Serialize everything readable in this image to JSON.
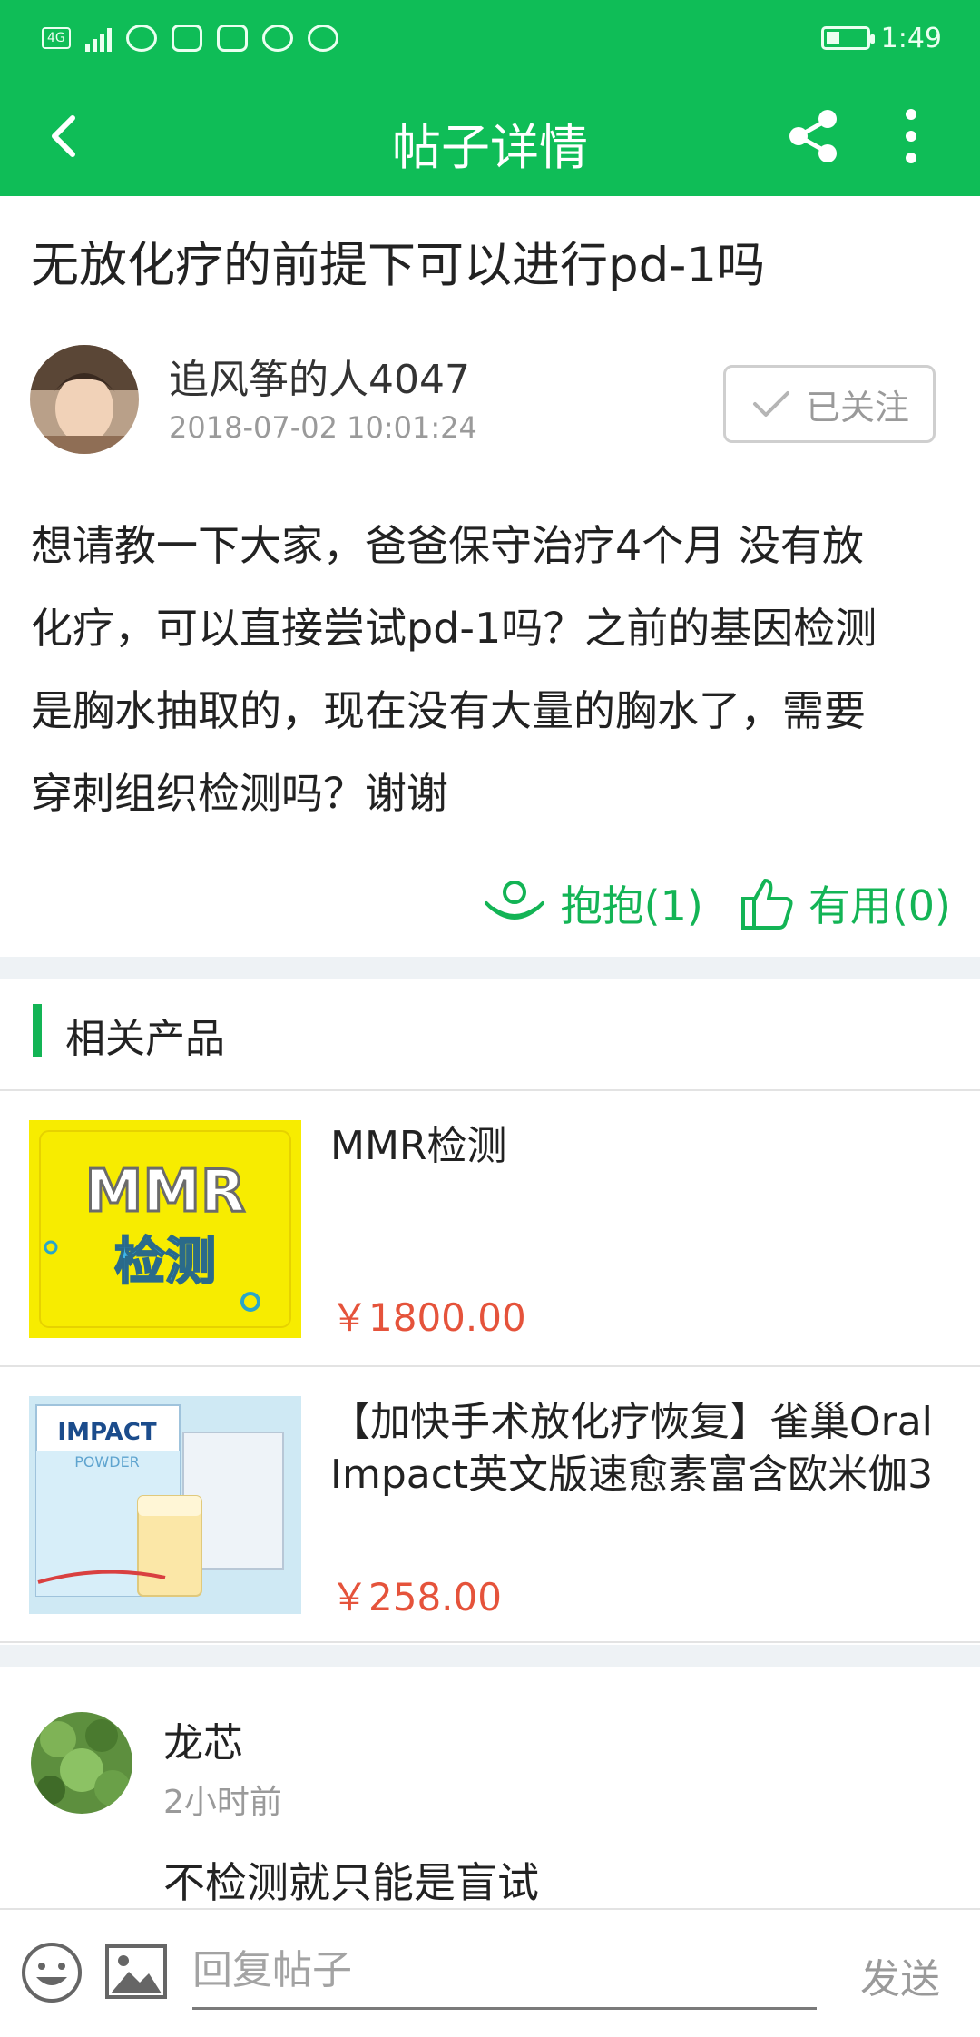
{
  "status_bar": {
    "network": "4G",
    "time": "1:49"
  },
  "app_bar": {
    "title": "帖子详情",
    "back_icon": "back-arrow-icon",
    "share_icon": "share-icon",
    "more_icon": "more-vertical-icon"
  },
  "post": {
    "title": "无放化疗的前提下可以进行pd-1吗",
    "author": "追风筝的人4047",
    "time": "2018-07-02 10:01:24",
    "follow_label": "已关注",
    "body_lines": [
      "想请教一下大家，爸爸保守治疗4个月 没有放",
      "化疗，可以直接尝试pd-1吗？之前的基因检测",
      "是胸水抽取的，现在没有大量的胸水了，需要",
      "穿刺组织检测吗？谢谢"
    ],
    "hug_label": "抱抱(1)",
    "useful_label": "有用(0)"
  },
  "related": {
    "title": "相关产品",
    "products": [
      {
        "name": "MMR检测",
        "price": "￥1800.00",
        "image_text_1": "MMR",
        "image_text_2": "检测"
      },
      {
        "name": "【加快手术放化疗恢复】雀巢Oral Impact英文版速愈素富含欧米伽3",
        "price": "￥258.00",
        "image_text_1": "IMPACT",
        "image_text_2": "POWDER"
      }
    ]
  },
  "comment": {
    "author": "龙芯",
    "time": "2小时前",
    "text": "不检测就只能是盲试"
  },
  "reply_bar": {
    "placeholder": "回复帖子",
    "send_label": "发送"
  },
  "colors": {
    "brand_green": "#0fbd57",
    "action_green": "#13b455",
    "price_red": "#e5533b"
  }
}
